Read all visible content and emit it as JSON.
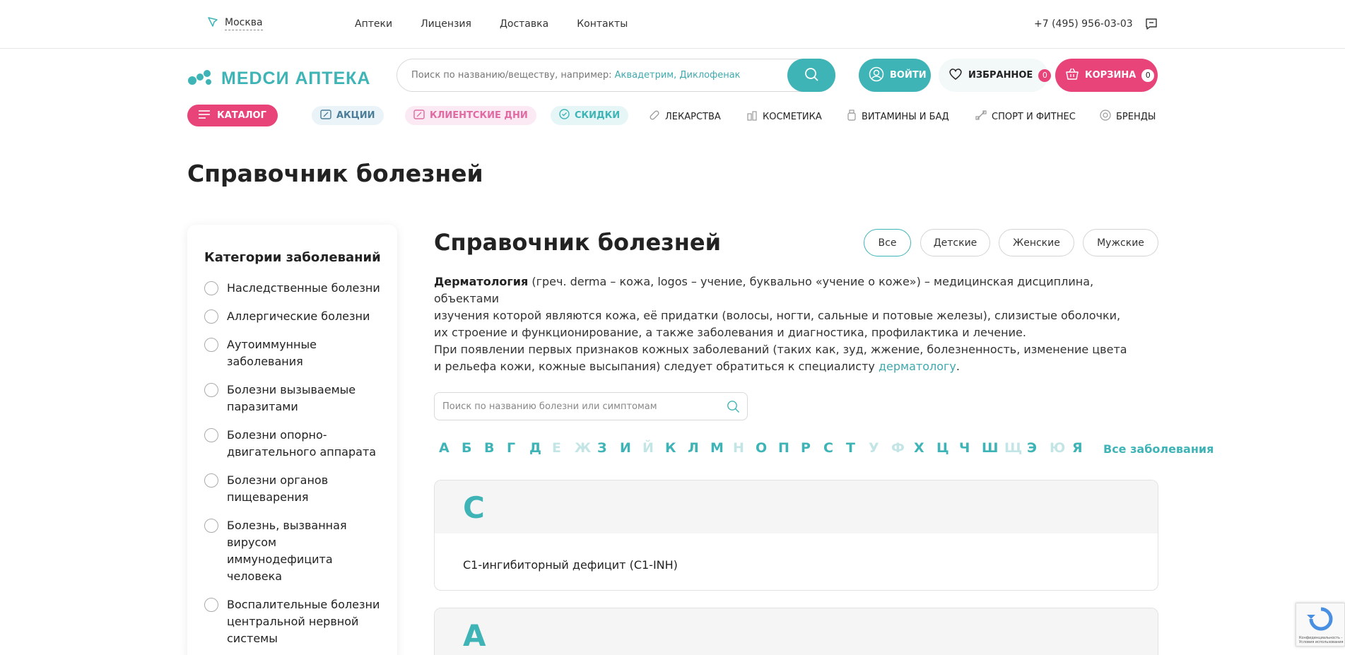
{
  "topbar": {
    "city": "Москва",
    "nav": [
      "Аптеки",
      "Лицензия",
      "Доставка",
      "Контакты"
    ],
    "phone": "+7 (495) 956-03-03"
  },
  "header": {
    "logo": "МЕDСИ АПТЕКА",
    "search_placeholder": "Поиск по названию/веществу, например: ",
    "search_examples": "Аквадетрим, Диклофенак",
    "login": "ВОЙТИ",
    "favorites": "ИЗБРАННОЕ",
    "favorites_count": "0",
    "cart": "КОРЗИНА",
    "cart_count": "0"
  },
  "catalog_bar": {
    "catalog": "КАТАЛОГ",
    "akcii": "АКЦИИ",
    "client_days": "КЛИЕНТСКИЕ ДНИ",
    "skidki": "СКИДКИ",
    "lekarstva": "ЛЕКАРСТВА",
    "kosmetika": "КОСМЕТИКА",
    "vitaminy": "ВИТАМИНЫ И БАД",
    "sport": "СПОРТ И ФИТНЕС",
    "brendy": "БРЕНДЫ"
  },
  "page_title": "Справочник болезней",
  "sidebar": {
    "title": "Категории заболеваний",
    "items": [
      "Наследственные болезни",
      "Аллергические болезни",
      "Аутоиммунные заболевания",
      "Болезни вызываемые паразитами",
      "Болезни опорно-двигательного аппарата",
      "Болезни органов пищеварения",
      "Болезнь, вызванная вирусом иммунодефицита человека",
      "Воспалительные болезни центральной нервной системы"
    ]
  },
  "main": {
    "title": "Справочник болезней",
    "filters": [
      "Все",
      "Детские",
      "Женские",
      "Мужские"
    ],
    "active_filter": "Все",
    "desc1_bold": "Дерматология",
    "desc1_line1": " (греч. derma – кожа, logos – учение, буквально «учение о коже») – медицинская дисциплина, объектами",
    "desc1_line2": "изучения которой являются кожа, её придатки (волосы, ногти, сальные и потовые железы), слизистые оболочки,",
    "desc1_line3": "их строение и функционирование, а также заболевания и диагностика, профилактика и лечение.",
    "desc2_line1": "При появлении первых признаков кожных заболеваний (таких как, зуд, жжение, болезненность, изменение цвета",
    "desc2_line2": "и рельефа кожи, кожные высыпания) следует обратиться к специалисту ",
    "desc2_link": "дерматологу",
    "desc2_end": ".",
    "search_placeholder": "Поиск по названию болезни или симптомам",
    "alphabet": [
      "А",
      "Б",
      "В",
      "Г",
      "Д",
      "Е",
      "Ж",
      "З",
      "И",
      "Й",
      "К",
      "Л",
      "М",
      "Н",
      "О",
      "П",
      "Р",
      "С",
      "Т",
      "У",
      "Ф",
      "Х",
      "Ц",
      "Ч",
      "Ш",
      "Щ",
      "Э",
      "Ю",
      "Я"
    ],
    "alphabet_disabled": [
      "Е",
      "Ж",
      "Й",
      "Н",
      "У",
      "Ф",
      "Щ",
      "Ю"
    ],
    "all_diseases": "Все заболевания",
    "groups": [
      {
        "letter": "C",
        "items": [
          "C1-ингибиторный дефицит (C1-INH)"
        ]
      },
      {
        "letter": "А",
        "items": []
      }
    ]
  },
  "recaptcha_text": "Конфиденциальность - Условия использования",
  "colors": {
    "teal": "#3fb4b7",
    "pink": "#e8447a"
  }
}
